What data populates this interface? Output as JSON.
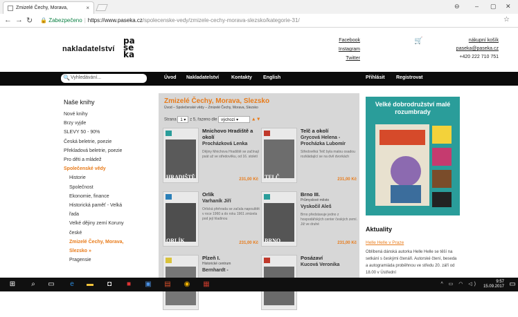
{
  "browser": {
    "tab_title": "Zmizelé Čechy, Morava,",
    "tab_close": "×",
    "secure_label": "Zabezpečeno",
    "url_host": "https://www.paseka.cz",
    "url_path": "/spolecenske-vedy/zmizele-cechy-morava-slezsko/kategorie-31/",
    "window_controls": [
      "⊖",
      "–",
      "▢",
      "✕"
    ]
  },
  "header": {
    "brand_text": "nakladatelství",
    "brand_mark": [
      "pa",
      "se",
      "ka"
    ],
    "social": [
      "Facebook",
      "Instagram",
      "Twitter"
    ],
    "cart_label": "nákupní košík",
    "email": "paseka@paseka.cz",
    "phone": "+420 222 710 751"
  },
  "nav": {
    "search_placeholder": "Vyhledávání...",
    "items": [
      "Úvod",
      "Nakladatelství",
      "Kontakty",
      "English"
    ],
    "right_items": [
      "Přihlásit",
      "Registrovat"
    ]
  },
  "left": {
    "title": "Naše knihy",
    "items": [
      {
        "label": "Nové knihy",
        "active": false
      },
      {
        "label": "Brzy vyjde",
        "active": false
      },
      {
        "label": "SLEVY 50 - 90%",
        "active": false
      },
      {
        "label": "Česká beletrie, poezie",
        "active": false
      },
      {
        "label": "Překladová beletrie, poezie",
        "active": false
      },
      {
        "label": "Pro děti a mládež",
        "active": false
      },
      {
        "label": "Společenské vědy",
        "active": true
      }
    ],
    "subitems": [
      {
        "label": "Historie",
        "active": false
      },
      {
        "label": "Společnost",
        "active": false
      },
      {
        "label": "Ekonomie, finance",
        "active": false
      },
      {
        "label": "Historická paměť - Velká",
        "active": false
      },
      {
        "label": "řada",
        "active": false
      },
      {
        "label": "Velké dějiny zemí Koruny",
        "active": false
      },
      {
        "label": "české",
        "active": false
      },
      {
        "label": "Zmizelé Čechy, Morava,",
        "active": true
      },
      {
        "label": "Slezsko  »",
        "active": true
      },
      {
        "label": "Pragensie",
        "active": false
      }
    ]
  },
  "main": {
    "title": "Zmizelé Čechy, Morava, Slezsko",
    "breadcrumb": "Úvod – Společenské vědy – Zmizelé Čechy, Morava, Slezsko",
    "pager": {
      "page_label": "Strana",
      "page_value": "1",
      "of_label": "z 5, řazeno dle",
      "sort_value": "výchozí",
      "sort_arrows": "▲▼"
    },
    "books": [
      {
        "title": "Mnichovo Hradiště a okolí",
        "subtitle": "",
        "author": "Procházková Lenka",
        "desc": "Dějiny Mnichova Hradiště se začínají psát už ve středověku, od 16. století",
        "price": "231,00 Kč",
        "cover_text": "HRADIŠTĚ",
        "cover_color": "#5a5a5a",
        "mark_color": "#2a9d9a"
      },
      {
        "title": "Telč a okolí",
        "subtitle": "",
        "author": "Grycová Helena - Procházka Lubomír",
        "desc": "Středověká Telč byla malou osadou rozkládající se na dvě dvorkách",
        "price": "231,00 Kč",
        "cover_text": "TELČ",
        "cover_color": "#6d6d6d",
        "mark_color": "#c0392b"
      },
      {
        "title": "Orlík",
        "subtitle": "",
        "author": "Varhaník Jiří",
        "desc": "Orlická přehrada se začala napouštět v roce 1960 a do roku 1961 zmizela pod její hladinou",
        "price": "231,00 Kč",
        "cover_text": "ORLÍK",
        "cover_color": "#4e4e4e",
        "mark_color": "#2a7fb8"
      },
      {
        "title": "Brno III.",
        "subtitle": "Průmyslové město",
        "author": "Vyskočil Aleš",
        "desc": "Brno představuje jedno z hospodářských center českých zemí. Již ve druhé",
        "price": "231,00 Kč",
        "cover_text": "BRNO",
        "cover_color": "#555555",
        "mark_color": "#2a9d9a"
      },
      {
        "title": "Plzeň I.",
        "subtitle": "Historické centrum",
        "author": "Bernhardt -",
        "desc": "",
        "price": "",
        "cover_text": "",
        "cover_color": "#777777",
        "mark_color": "#d9c23a"
      },
      {
        "title": "Posázaví",
        "subtitle": "",
        "author": "Kucová Veronika",
        "desc": "",
        "price": "",
        "cover_text": "",
        "cover_color": "#6a6a6a",
        "mark_color": "#c0392b"
      }
    ]
  },
  "right": {
    "promo_title": "Velké dobrodružství malé rozumbrady",
    "aktuality_title": "Aktuality",
    "news_link": "Helle Helle v Praze",
    "news_text": "Oblíbená dánská autorka Helle Helle se těší na setkání s českými čtenáři. Autorské čtení, beseda a autogramiáda proběhnou ve středu 20. září od 18.00 v Ústřední"
  },
  "taskbar": {
    "time": "9:57",
    "date": "15.09.2017"
  }
}
